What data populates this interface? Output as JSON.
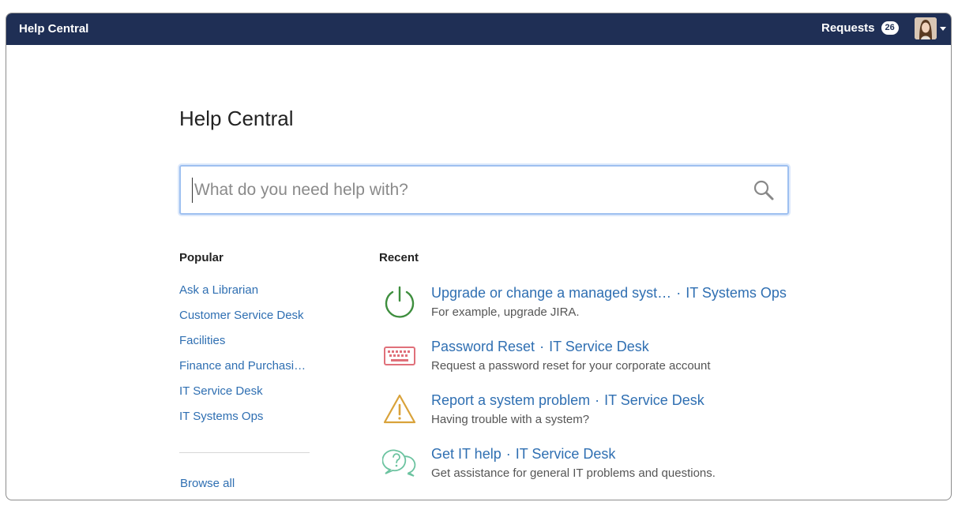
{
  "topbar": {
    "brand": "Help Central",
    "requests_label": "Requests",
    "requests_count": "26",
    "bar_color": "#1f2f55"
  },
  "page": {
    "title": "Help Central"
  },
  "search": {
    "placeholder": "What do you need help with?",
    "value": ""
  },
  "popular": {
    "heading": "Popular",
    "items": [
      {
        "label": "Ask a Librarian"
      },
      {
        "label": "Customer Service Desk"
      },
      {
        "label": "Facilities"
      },
      {
        "label": "Finance and Purchasi…"
      },
      {
        "label": "IT Service Desk"
      },
      {
        "label": "IT Systems Ops"
      }
    ],
    "browse_all": "Browse all"
  },
  "recent": {
    "heading": "Recent",
    "separator": "·",
    "items": [
      {
        "icon": "power-icon",
        "name": "Upgrade or change a managed syst…",
        "desk": "IT Systems Ops",
        "desc": "For example, upgrade JIRA."
      },
      {
        "icon": "keyboard-icon",
        "name": "Password Reset",
        "desk": "IT Service Desk",
        "desc": "Request a password reset for your corporate account"
      },
      {
        "icon": "warning-icon",
        "name": "Report a system problem",
        "desk": "IT Service Desk",
        "desc": "Having trouble with a system?"
      },
      {
        "icon": "help-chat-icon",
        "name": "Get IT help",
        "desk": "IT Service Desk",
        "desc": "Get assistance for general IT problems and questions."
      }
    ]
  },
  "colors": {
    "link": "#2f6fb2",
    "power_icon": "#3e8e3e",
    "keyboard_icon": "#e0707a",
    "warning_icon": "#d9a23a",
    "help_icon": "#6cc3a0"
  }
}
